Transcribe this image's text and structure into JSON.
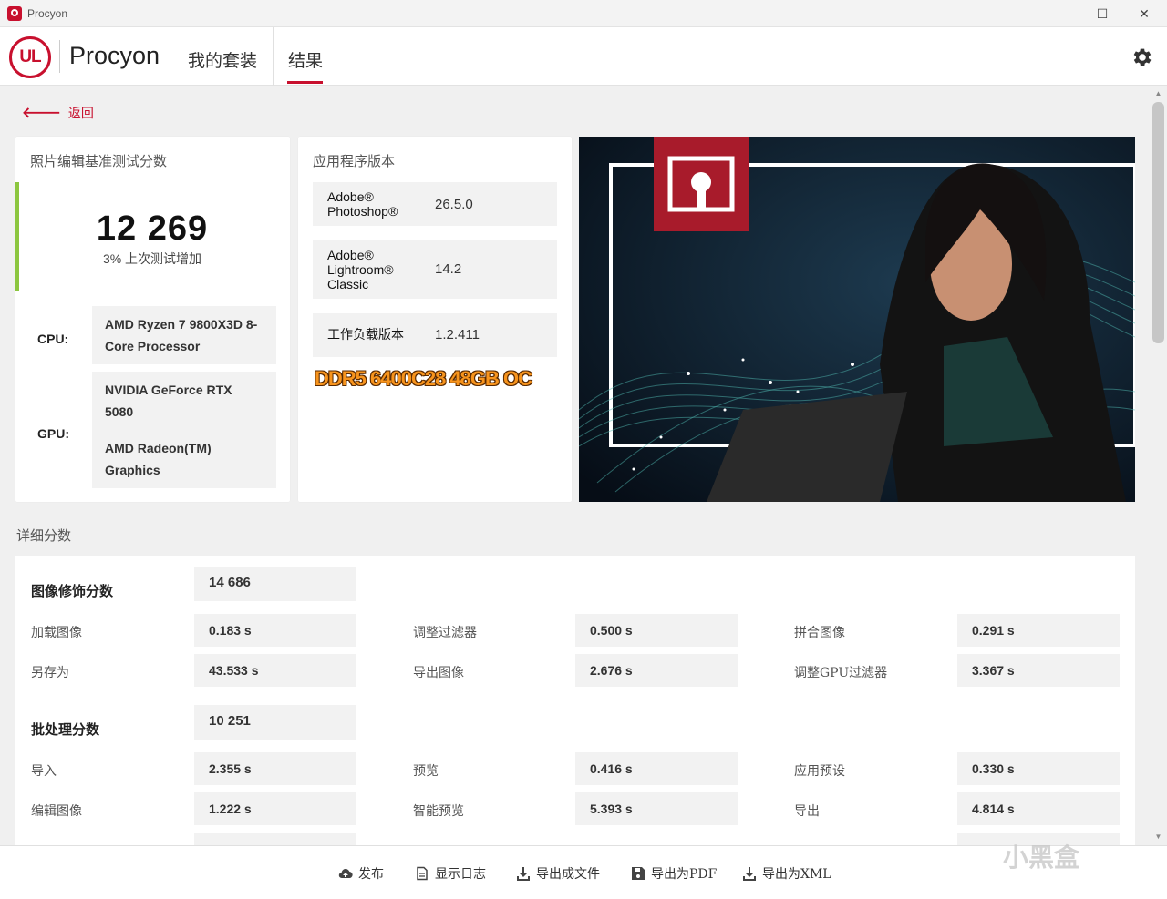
{
  "window": {
    "title": "Procyon",
    "minimize": "—",
    "maximize": "☐",
    "close": "✕"
  },
  "header": {
    "logo_text": "UL",
    "brand": "Procyon",
    "nav": [
      {
        "label": "我的套装"
      },
      {
        "label": "结果",
        "active": true
      }
    ]
  },
  "back": {
    "label": "返回"
  },
  "score_card": {
    "title": "照片编辑基准测试分数",
    "score": "12 269",
    "delta": "3% 上次测试增加",
    "cpu_label": "CPU:",
    "cpu_value": "AMD Ryzen 7 9800X3D 8-Core Processor",
    "gpu_label": "GPU:",
    "gpu_values": [
      "NVIDIA GeForce RTX 5080",
      "AMD Radeon(TM) Graphics"
    ]
  },
  "version_card": {
    "title": "应用程序版本",
    "rows": [
      {
        "name_lines": [
          "Adobe®",
          "Photoshop®"
        ],
        "version": "26.5.0"
      },
      {
        "name_lines": [
          "Adobe®",
          "Lightroom®",
          "Classic"
        ],
        "version": "14.2"
      },
      {
        "name_lines": [
          "工作负载版本"
        ],
        "version": "1.2.411"
      }
    ],
    "overlay_note": "DDR5 6400C28 48GB OC"
  },
  "details": {
    "title": "详细分数",
    "groups": [
      {
        "name": "图像修饰分数",
        "score": "14 686",
        "rows": [
          [
            {
              "label": "加载图像",
              "value": "0.183 s"
            },
            {
              "label": "调整过滤器",
              "value": "0.500 s"
            },
            {
              "label": "拼合图像",
              "value": "0.291 s"
            }
          ],
          [
            {
              "label": "另存为",
              "value": "43.533 s"
            },
            {
              "label": "导出图像",
              "value": "2.676 s"
            },
            {
              "label": "调整GPU过滤器",
              "value": "3.367 s"
            }
          ]
        ]
      },
      {
        "name": "批处理分数",
        "score": "10 251",
        "rows": [
          [
            {
              "label": "导入",
              "value": "2.355 s"
            },
            {
              "label": "预览",
              "value": "0.416 s"
            },
            {
              "label": "应用预设",
              "value": "0.330 s"
            }
          ],
          [
            {
              "label": "编辑图像",
              "value": "1.222 s"
            },
            {
              "label": "智能预览",
              "value": "5.393 s"
            },
            {
              "label": "导出",
              "value": "4.814 s"
            }
          ]
        ]
      }
    ]
  },
  "toolbar": {
    "publish": "发布",
    "show_log": "显示日志",
    "export_file": "导出成文件",
    "export_pdf": "导出为PDF",
    "export_xml": "导出为XML"
  },
  "watermark": "小黑盒",
  "colors": {
    "accent": "#c8102e",
    "score_bar": "#8cc63f",
    "overlay": "#f7941d"
  }
}
